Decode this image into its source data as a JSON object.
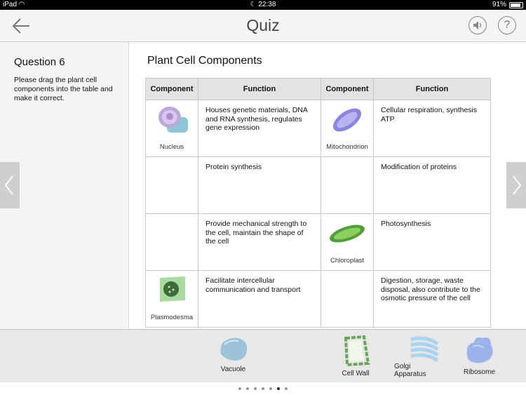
{
  "status": {
    "device": "iPad",
    "time": "22:38",
    "battery_text": "91%",
    "battery_level": 0.91
  },
  "nav": {
    "title": "Quiz"
  },
  "question": {
    "title": "Question 6",
    "text": "Please drag the plant cell components into the table and make it correct."
  },
  "main": {
    "title": "Plant Cell Components"
  },
  "table": {
    "headers": [
      "Component",
      "Function",
      "Component",
      "Function"
    ],
    "rows": [
      {
        "comp_left": "Nucleus",
        "func_left": "Houses genetic materials, DNA and RNA synthesis, regulates gene expression",
        "comp_right": "Mitochondrion",
        "func_right": "Cellular respiration, synthesis ATP"
      },
      {
        "comp_left": "",
        "func_left": "Protein synthesis",
        "comp_right": "",
        "func_right": "Modification of proteins"
      },
      {
        "comp_left": "",
        "func_left": "Provide mechanical strength to the cell, maintain the shape of the cell",
        "comp_right": "Chloroplast",
        "func_right": "Photosynthesis"
      },
      {
        "comp_left": "Plasmodesma",
        "func_left": "Facilitate intercellular communication and transport",
        "comp_right": "",
        "func_right": "Digestion, storage, waste disposal, also contribute to the osmotic pressure of the cell"
      }
    ]
  },
  "tray": {
    "items": [
      {
        "label": "Vacuole",
        "icon": "vacuole-icon"
      },
      {
        "label": "Cell Wall",
        "icon": "cell-wall-icon"
      },
      {
        "label": "Golgi Apparatus",
        "line1": "Golgi",
        "line2": "Apparatus",
        "icon": "golgi-apparatus-icon"
      },
      {
        "label": "Ribosome",
        "icon": "ribosome-icon"
      }
    ]
  },
  "pager": {
    "count": 7,
    "active": 6
  }
}
